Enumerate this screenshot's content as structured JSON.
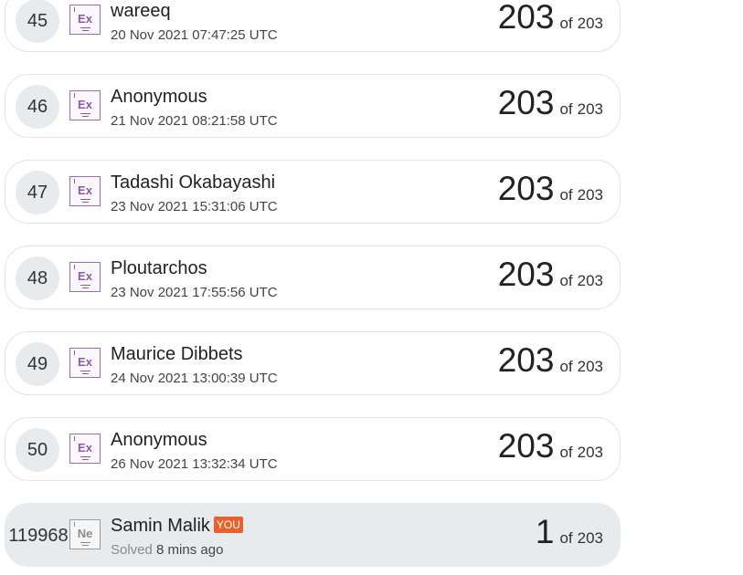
{
  "leaderboard": {
    "of_label": "of",
    "total": "203",
    "rows": [
      {
        "rank": "45",
        "name": "wareeq",
        "time": "20 Nov 2021 07:47:25 UTC",
        "score": "203",
        "badge": "Ex"
      },
      {
        "rank": "46",
        "name": "Anonymous",
        "time": "21 Nov 2021 08:21:58 UTC",
        "score": "203",
        "badge": "Ex"
      },
      {
        "rank": "47",
        "name": "Tadashi Okabayashi",
        "time": "23 Nov 2021 15:31:06 UTC",
        "score": "203",
        "badge": "Ex"
      },
      {
        "rank": "48",
        "name": "Ploutarchos",
        "time": "23 Nov 2021 17:55:56 UTC",
        "score": "203",
        "badge": "Ex"
      },
      {
        "rank": "49",
        "name": "Maurice Dibbets",
        "time": "24 Nov 2021 13:00:39 UTC",
        "score": "203",
        "badge": "Ex"
      },
      {
        "rank": "50",
        "name": "Anonymous",
        "time": "26 Nov 2021 13:32:34 UTC",
        "score": "203",
        "badge": "Ex"
      }
    ],
    "current_user": {
      "rank": "119968",
      "name": "Samin Malik",
      "you_tag": "YOU",
      "solved_label": "Solved",
      "solved_ago": "8 mins ago",
      "score": "1",
      "badge": "Ne"
    }
  },
  "colors": {
    "badge_purple": "#8c5aaa",
    "badge_grey": "#8a8a8a",
    "you_tag": "#e8612c",
    "highlight_row": "#e8ebed"
  }
}
